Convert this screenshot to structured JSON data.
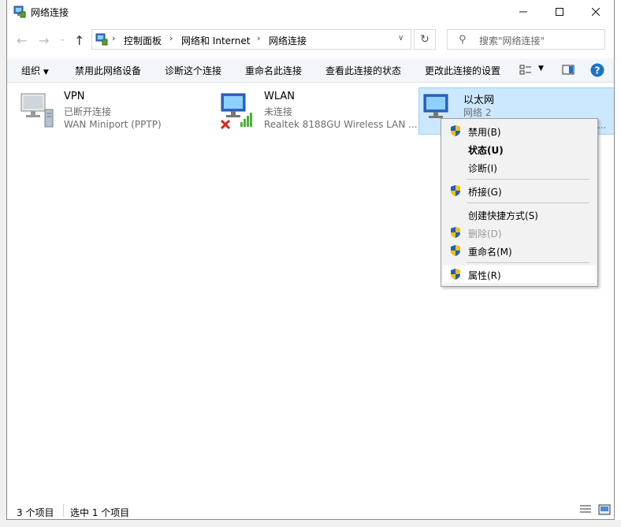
{
  "window": {
    "title": "网络连接",
    "icon": "network-connections-icon"
  },
  "nav": {
    "back_icon": "back-arrow-icon",
    "forward_icon": "forward-arrow-icon",
    "up_icon": "up-arrow-icon",
    "breadcrumb": [
      "控制面板",
      "网络和 Internet",
      "网络连接"
    ],
    "search_placeholder": "搜索\"网络连接\""
  },
  "toolbar": {
    "organize": "组织",
    "disable": "禁用此网络设备",
    "diagnose": "诊断这个连接",
    "rename": "重命名此连接",
    "view_status": "查看此连接的状态",
    "change_settings": "更改此连接的设置"
  },
  "connections": [
    {
      "name": "VPN",
      "status": "已断开连接",
      "device": "WAN Miniport (PPTP)"
    },
    {
      "name": "WLAN",
      "status": "未连接",
      "device": "Realtek 8188GU Wireless LAN ..."
    },
    {
      "name": "以太网",
      "status": "网络 2",
      "device": "r..."
    }
  ],
  "context_menu": [
    {
      "label": "禁用(B)",
      "shield": true,
      "bold": false,
      "disabled": false
    },
    {
      "label": "状态(U)",
      "shield": false,
      "bold": true,
      "disabled": false
    },
    {
      "label": "诊断(I)",
      "shield": false,
      "bold": false,
      "disabled": false
    },
    {
      "label": "桥接(G)",
      "shield": true,
      "bold": false,
      "disabled": false
    },
    {
      "label": "创建快捷方式(S)",
      "shield": false,
      "bold": false,
      "disabled": false
    },
    {
      "label": "删除(D)",
      "shield": true,
      "bold": false,
      "disabled": true
    },
    {
      "label": "重命名(M)",
      "shield": true,
      "bold": false,
      "disabled": false
    },
    {
      "label": "属性(R)",
      "shield": true,
      "bold": false,
      "disabled": false
    }
  ],
  "statusbar": {
    "count": "3 个项目",
    "selected": "选中 1 个项目"
  },
  "colors": {
    "accent": "#0078d7",
    "selection": "#cce8ff",
    "help": "#1a73c8"
  }
}
